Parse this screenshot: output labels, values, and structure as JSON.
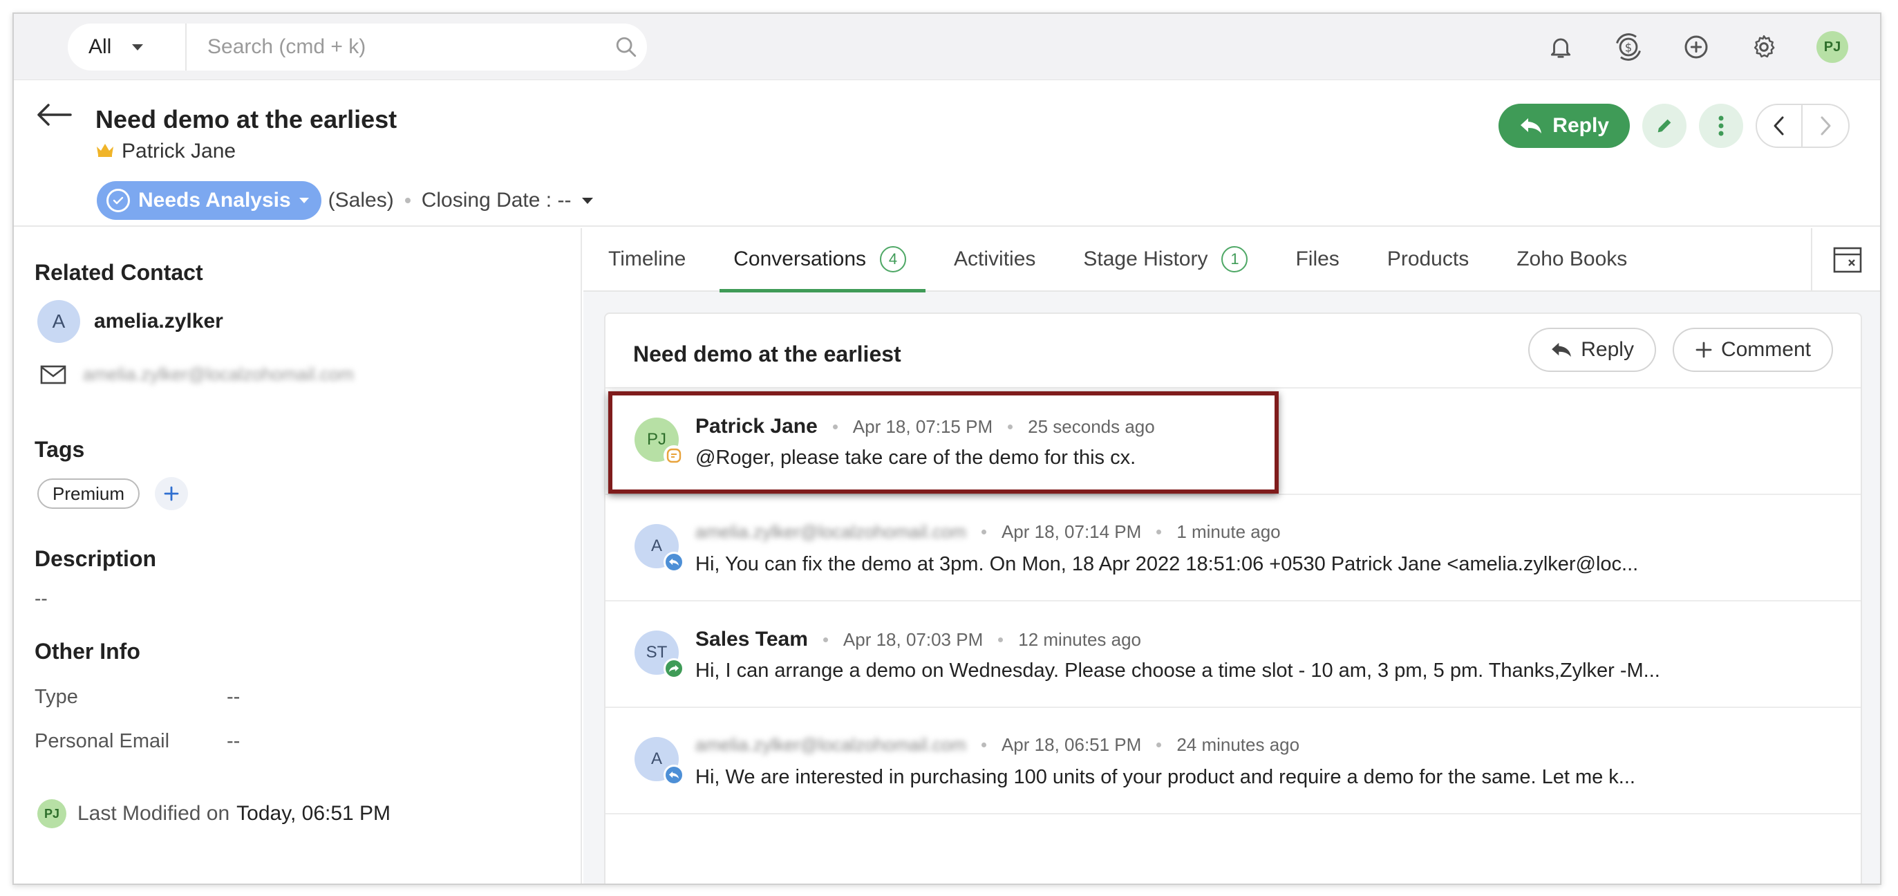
{
  "topbar": {
    "scope_select": "All",
    "search_placeholder": "Search (cmd + k)",
    "user_initials": "PJ",
    "icons": [
      "bell-icon",
      "currency-refresh-icon",
      "add-circle-icon",
      "gear-icon"
    ]
  },
  "header": {
    "title": "Need demo at the earliest",
    "owner": "Patrick Jane",
    "stage": "Needs Analysis",
    "pipeline": "(Sales)",
    "closing_date_label": "Closing Date : --",
    "reply_label": "Reply"
  },
  "left": {
    "related_contact_title": "Related Contact",
    "contact_initial": "A",
    "contact_name": "amelia.zylker",
    "contact_email": "amelia.zylker@localzohomail.com",
    "tags_title": "Tags",
    "tags": [
      "Premium"
    ],
    "description_title": "Description",
    "description_value": "--",
    "other_info_title": "Other Info",
    "other_info": [
      {
        "label": "Type",
        "value": "--"
      },
      {
        "label": "Personal Email",
        "value": "--"
      }
    ],
    "modified_initials": "PJ",
    "last_modified_label": "Last Modified on",
    "last_modified_value": "Today, 06:51 PM"
  },
  "tabs": [
    {
      "label": "Timeline",
      "count": null
    },
    {
      "label": "Conversations",
      "count": "4"
    },
    {
      "label": "Activities",
      "count": null
    },
    {
      "label": "Stage History",
      "count": "1"
    },
    {
      "label": "Files",
      "count": null
    },
    {
      "label": "Products",
      "count": null
    },
    {
      "label": "Zoho Books",
      "count": null
    }
  ],
  "active_tab": "Conversations",
  "conversation": {
    "title": "Need demo at the earliest",
    "reply_label": "Reply",
    "comment_label": "Comment",
    "messages": [
      {
        "initials": "PJ",
        "sender": "Patrick Jane",
        "date": "Apr 18, 07:15 PM",
        "ago": "25 seconds ago",
        "body": "@Roger, please take care of the demo for this cx.",
        "type": "note"
      },
      {
        "initials": "A",
        "sender": "amelia.zylker@localzohomail.com",
        "date": "Apr 18, 07:14 PM",
        "ago": "1 minute ago",
        "body": "Hi, You can fix the demo at 3pm. On Mon, 18 Apr 2022 18:51:06 +0530 Patrick Jane <amelia.zylker@loc...",
        "type": "incoming"
      },
      {
        "initials": "ST",
        "sender": "Sales Team",
        "date": "Apr 18, 07:03 PM",
        "ago": "12 minutes ago",
        "body": "Hi, I can arrange a demo on Wednesday. Please choose a time slot - 10 am, 3 pm, 5 pm. Thanks,Zylker -M...",
        "type": "outgoing"
      },
      {
        "initials": "A",
        "sender": "amelia.zylker@localzohomail.com",
        "date": "Apr 18, 06:51 PM",
        "ago": "24 minutes ago",
        "body": "Hi, We are interested in purchasing 100 units of your product and require a demo for the same. Let me k...",
        "type": "incoming"
      }
    ]
  },
  "colors": {
    "accent_green": "#3f9b57",
    "stage_blue": "#7ca8f0",
    "highlight": "#7f1c1c"
  }
}
